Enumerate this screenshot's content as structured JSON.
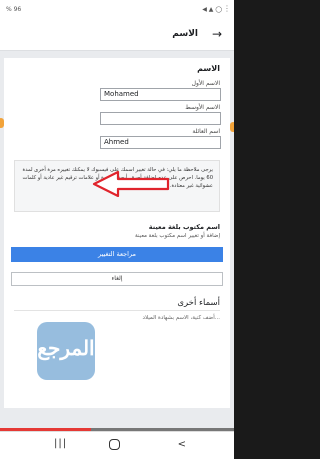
{
  "statusbar": {
    "left": "% 96",
    "right": "◀ ▲ ◯",
    "more": "⋮"
  },
  "header": {
    "title": "الاسم",
    "back": "→"
  },
  "name_section": {
    "title": "الاسم",
    "first_label": "الاسم الأول",
    "first_value": "Mohamed",
    "middle_label": "الاسم الأوسط",
    "middle_value": "",
    "last_label": "اسم العائلة",
    "last_value": "Ahmed"
  },
  "note": "يرجى ملاحظة ما يلي: في حالة تغيير اسمك على فيسبوك لا يمكنك تغييره مرة أخرى لمدة 60 يوما. احرص على عدم إضافة أحرف أبجدية كبيرة أو علامات ترقيم غير عادية أو كلمات عشوائية غير معتادة. تعرّف على المزيد.",
  "lang_section": {
    "title": "اسم مكتوب بلغة معينة",
    "desc": "إضافة أو تغيير اسم مكتوب بلغة معينة"
  },
  "buttons": {
    "review": "مراجعة التغيير",
    "cancel": "إلغاء"
  },
  "other_names": {
    "title": "أسماء أخرى",
    "desc": "أضف كنية، الاسم بشهادة الميلاد..."
  },
  "watermark": {
    "text": "المرجع"
  },
  "video_progress": 0.39,
  "navbar": {
    "recent": "|||",
    "back": "<"
  },
  "colors": {
    "primary_button": "#3b82e6",
    "arrow": "#e0242c",
    "progress": "#e53935"
  }
}
